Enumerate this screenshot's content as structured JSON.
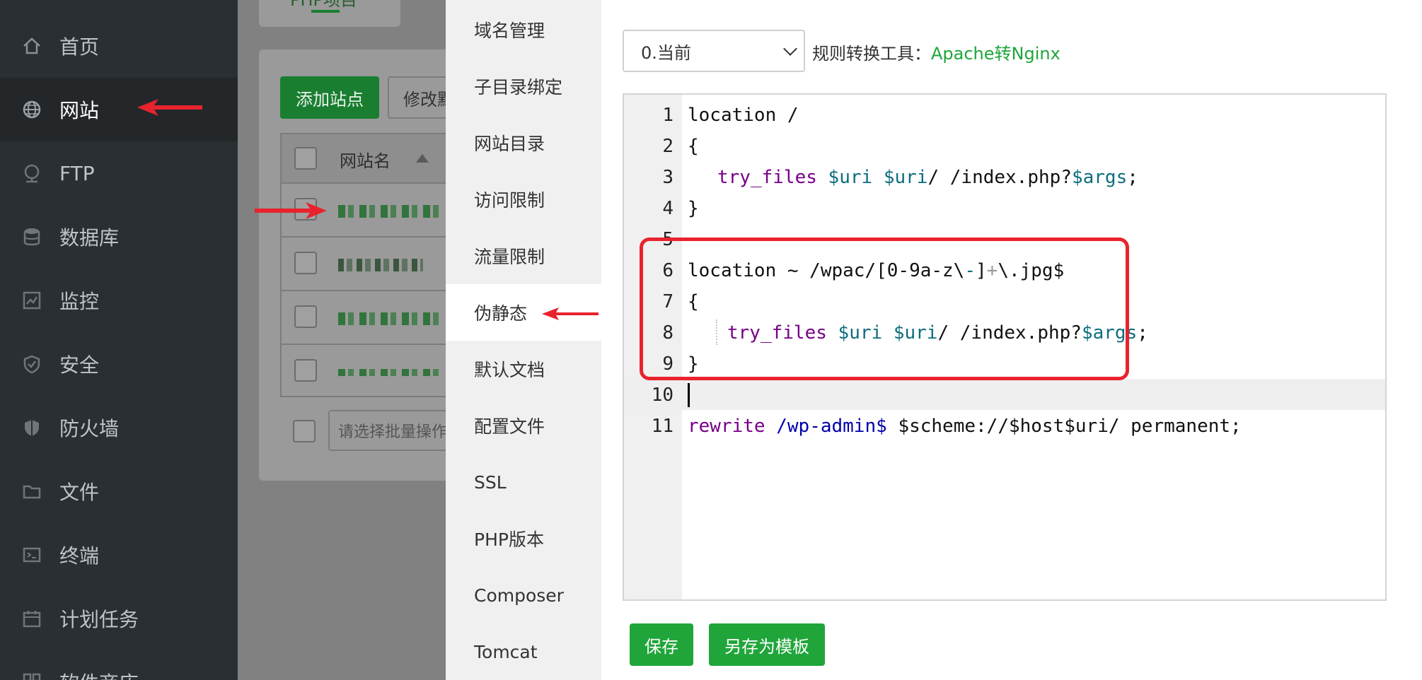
{
  "sidebar": {
    "items": [
      {
        "label": "首页",
        "icon": "home-icon"
      },
      {
        "label": "网站",
        "icon": "globe-icon"
      },
      {
        "label": "FTP",
        "icon": "ftp-icon"
      },
      {
        "label": "数据库",
        "icon": "database-icon"
      },
      {
        "label": "监控",
        "icon": "monitor-icon"
      },
      {
        "label": "安全",
        "icon": "shield-icon"
      },
      {
        "label": "防火墙",
        "icon": "firewall-icon"
      },
      {
        "label": "文件",
        "icon": "folder-icon"
      },
      {
        "label": "终端",
        "icon": "terminal-icon"
      },
      {
        "label": "计划任务",
        "icon": "calendar-icon"
      },
      {
        "label": "软件商店",
        "icon": "store-icon"
      }
    ],
    "active_index": 1
  },
  "background": {
    "tab_label": "PHP项目",
    "add_site_label": "添加站点",
    "modify_label": "修改默认页",
    "table_header": "网站名",
    "batch_placeholder": "请选择批量操作"
  },
  "settings_menu": {
    "items": [
      "域名管理",
      "子目录绑定",
      "网站目录",
      "访问限制",
      "流量限制",
      "伪静态",
      "默认文档",
      "配置文件",
      "SSL",
      "PHP版本",
      "Composer",
      "Tomcat"
    ],
    "active_index": 5
  },
  "editor_panel": {
    "version_value": "0.当前",
    "tool_label": "规则转换工具：",
    "tool_link": "Apache转Nginx",
    "save_label": "保存",
    "save_template_label": "另存为模板"
  },
  "code": {
    "line_numbers": [
      "1",
      "2",
      "3",
      "4",
      "5",
      "6",
      "7",
      "8",
      "9",
      "10",
      "11"
    ],
    "l1": "location /",
    "l2": "{",
    "l3_a": "try_files",
    "l3_b": "$uri",
    "l3_c": "$uri",
    "l3_d": "/ /index.php?",
    "l3_e": "$args",
    "l3_f": ";",
    "l4": "}",
    "l5": "",
    "l6_a": "location ~ /wpac/[0-9a-z\\",
    "l6_b": "-",
    "l6_c": "]",
    "l6_d": "+",
    "l6_e": "\\.jpg$",
    "l7": "{",
    "l8_a": "try_files",
    "l8_b": "$uri",
    "l8_c": "$uri",
    "l8_d": "/ /index.php?",
    "l8_e": "$args",
    "l8_f": ";",
    "l9": "}",
    "l11_a": "rewrite",
    "l11_b": "/wp-admin$",
    "l11_c": "$scheme://$host$uri/ permanent;"
  },
  "colors": {
    "accent": "#20a53a",
    "sidebar_bg": "#2a2f33",
    "annotation_red": "#e8232d"
  }
}
